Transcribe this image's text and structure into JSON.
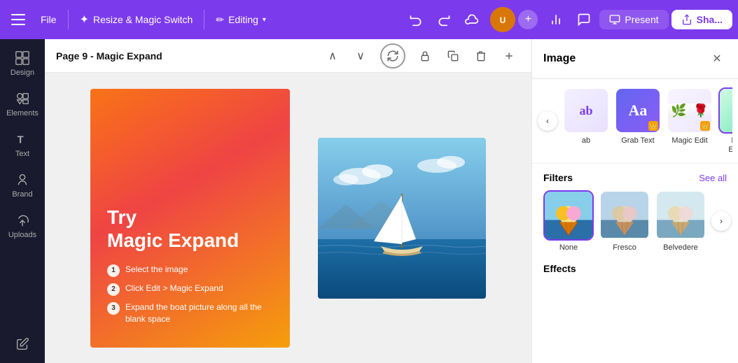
{
  "topbar": {
    "menu_icon": "☰",
    "file_label": "File",
    "resize_label": "Resize & Magic Switch",
    "editing_label": "Editing",
    "undo_icon": "↩",
    "redo_icon": "↪",
    "cloud_icon": "☁",
    "add_icon": "+",
    "chart_icon": "📊",
    "chat_icon": "💬",
    "cast_icon": "📺",
    "present_label": "Present",
    "share_label": "Sha..."
  },
  "sidebar": {
    "items": [
      {
        "label": "Design",
        "icon": "design"
      },
      {
        "label": "Elements",
        "icon": "elements"
      },
      {
        "label": "Text",
        "icon": "text"
      },
      {
        "label": "Brand",
        "icon": "brand"
      },
      {
        "label": "Uploads",
        "icon": "uploads"
      }
    ]
  },
  "page": {
    "title": "Page 9 - Magic Expand",
    "up_icon": "∧",
    "down_icon": "∨",
    "lock_icon": "🔒",
    "copy_icon": "⧉",
    "delete_icon": "🗑",
    "add_icon": "+"
  },
  "canvas": {
    "design_title": "Try\nMagic Expand",
    "step1": "Select the image",
    "step2": "Click Edit > Magic Expand",
    "step3": "Expand the boat picture along all the blank space"
  },
  "panel": {
    "title": "Image",
    "close_icon": "✕",
    "nav_left": "‹",
    "nav_right": "›",
    "options": [
      {
        "label": "ab",
        "type": "ab"
      },
      {
        "label": "Grab Text",
        "type": "grab-text",
        "badge": "crown"
      },
      {
        "label": "Magic Edit",
        "type": "magic-edit",
        "badge": "crown"
      },
      {
        "label": "Magic\nExpand",
        "type": "magic-expand",
        "badge": "diamond",
        "selected": true
      }
    ],
    "filters_title": "Filters",
    "see_all": "See all",
    "filters": [
      {
        "label": "None",
        "type": "none",
        "selected": true
      },
      {
        "label": "Fresco",
        "type": "fresco"
      },
      {
        "label": "Belvedere",
        "type": "belvedere"
      }
    ],
    "effects_title": "Effects"
  }
}
